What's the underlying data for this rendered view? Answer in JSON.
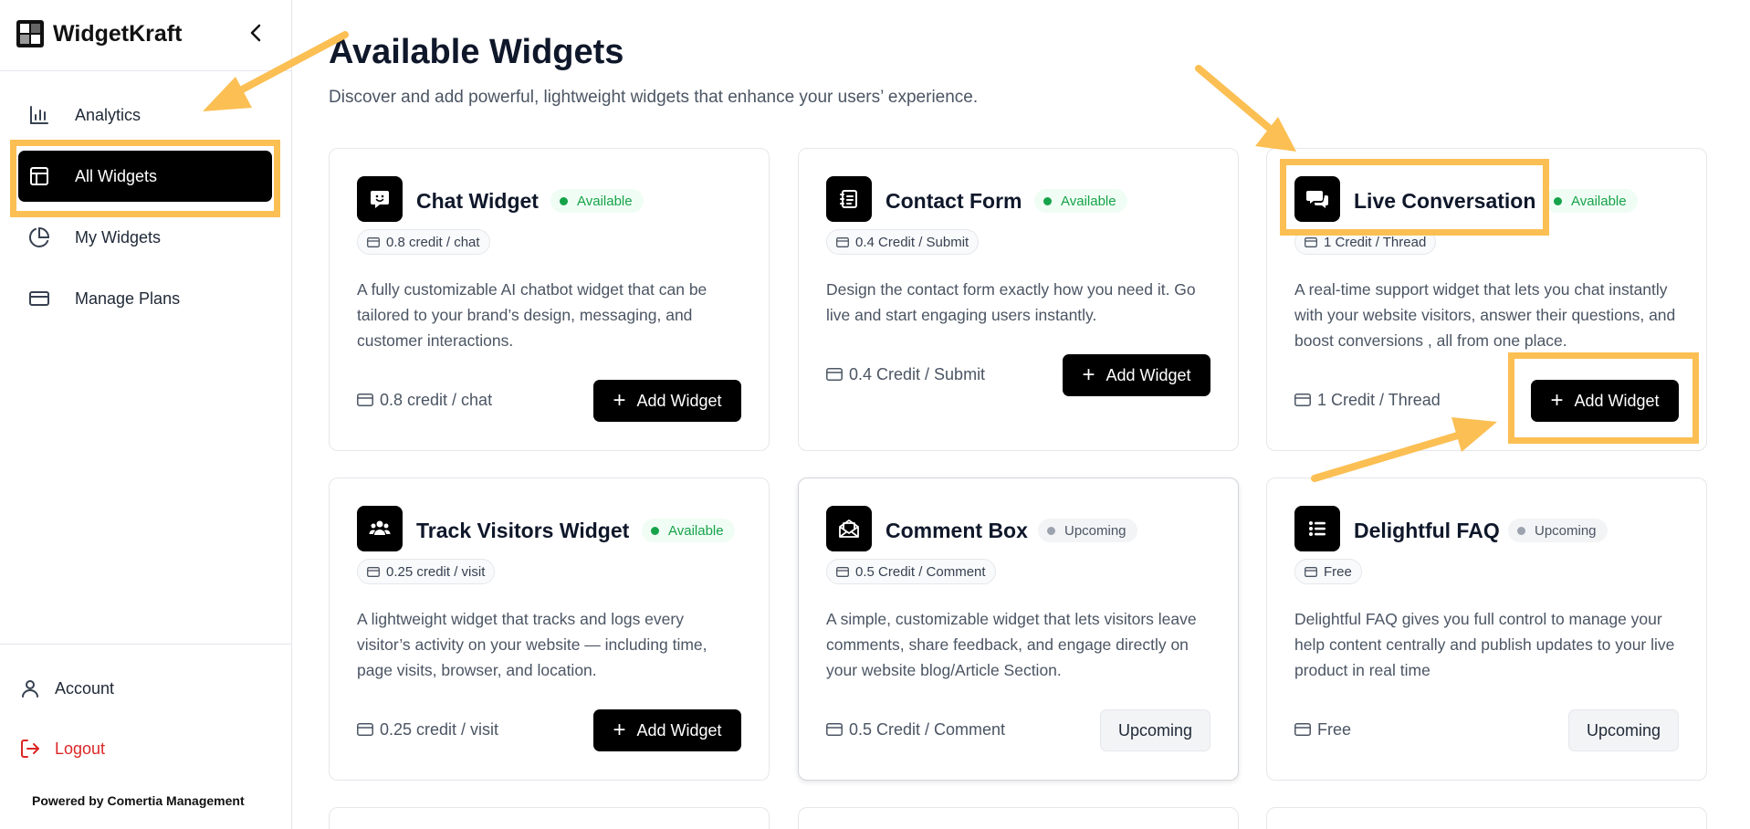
{
  "app": {
    "name": "WidgetKraft"
  },
  "sidebar": {
    "items": [
      {
        "label": "Analytics",
        "icon": "bar-chart-icon"
      },
      {
        "label": "All Widgets",
        "icon": "layout-icon",
        "active": true
      },
      {
        "label": "My Widgets",
        "icon": "pie-chart-icon"
      },
      {
        "label": "Manage Plans",
        "icon": "credit-card-icon"
      }
    ],
    "account_label": "Account",
    "logout_label": "Logout",
    "powered_by": "Powered by Comertia Management"
  },
  "main": {
    "title": "Available Widgets",
    "subtitle": "Discover and add powerful, lightweight widgets that enhance your users’ experience.",
    "widgets": [
      {
        "name": "Chat Widget",
        "status": "Available",
        "chip": "0.8 credit / chat",
        "description": "A fully customizable AI chatbot widget that can be tailored to your brand’s design, messaging, and customer interactions.",
        "price": "0.8 credit / chat",
        "button": "Add Widget",
        "icon": "chat-bot-icon"
      },
      {
        "name": "Contact Form",
        "status": "Available",
        "chip": "0.4 Credit / Submit",
        "description": "Design the contact form exactly how you need it. Go live and start engaging users instantly.",
        "price": "0.4 Credit / Submit",
        "button": "Add Widget",
        "icon": "contact-book-icon"
      },
      {
        "name": "Live Conversation",
        "status": "Available",
        "chip": "1 Credit / Thread",
        "description": "A real-time support widget that lets you chat instantly with your website visitors, answer their questions, and boost conversions , all from one place.",
        "price": "1 Credit / Thread",
        "button": "Add Widget",
        "icon": "chat-bubbles-icon"
      },
      {
        "name": "Track Visitors Widget",
        "status": "Available",
        "chip": "0.25 credit / visit",
        "description": "A lightweight widget that tracks and logs every visitor’s activity on your website — including time, page visits, browser, and location.",
        "price": "0.25 credit / visit",
        "button": "Add Widget",
        "icon": "users-icon"
      },
      {
        "name": "Comment Box",
        "status": "Upcoming",
        "chip": "0.5 Credit / Comment",
        "description": "A simple, customizable widget that lets visitors leave comments, share feedback, and engage directly on your website blog/Article Section.",
        "price": "0.5 Credit / Comment",
        "button": "Upcoming",
        "icon": "mail-open-icon"
      },
      {
        "name": "Delightful FAQ",
        "status": "Upcoming",
        "chip": "Free",
        "description": "Delightful FAQ gives you full control to manage your help content centrally and publish updates to your live product in real time",
        "price": "Free",
        "button": "Upcoming",
        "icon": "list-icon"
      }
    ]
  },
  "colors": {
    "annotation": "#fbbf53",
    "available": "#16a34a",
    "logout": "#dc2626",
    "accent": "#000000"
  }
}
